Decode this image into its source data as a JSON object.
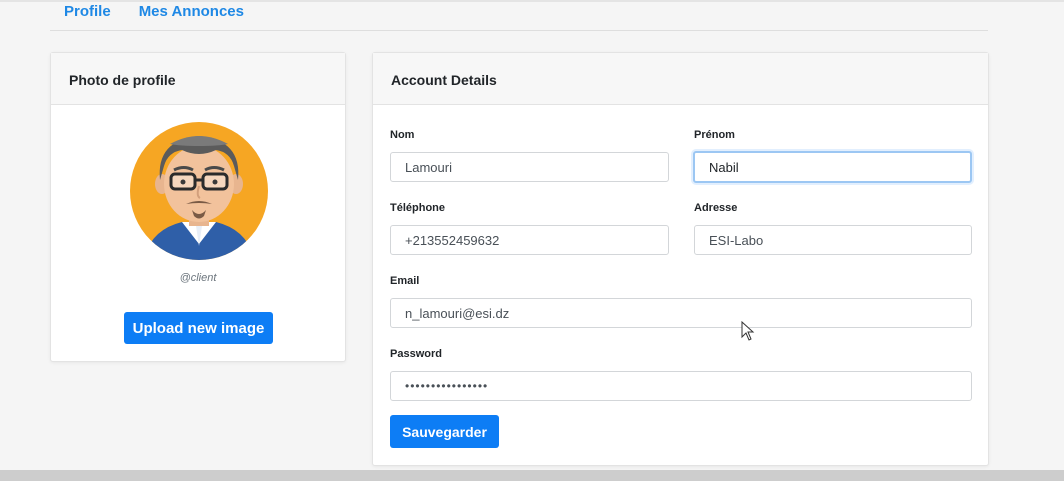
{
  "nav": {
    "profile": "Profile",
    "annonces": "Mes Annonces"
  },
  "profile_card": {
    "title": "Photo de profile",
    "handle": "@client",
    "upload_label": "Upload new image"
  },
  "account": {
    "title": "Account Details",
    "nom_label": "Nom",
    "nom_value": "Lamouri",
    "prenom_label": "Prénom",
    "prenom_value": "Nabil",
    "telephone_label": "Téléphone",
    "telephone_value": "+213552459632",
    "adresse_label": "Adresse",
    "adresse_value": "ESI-Labo",
    "email_label": "Email",
    "email_value": "n_lamouri@esi.dz",
    "password_label": "Password",
    "password_value": "••••••••••••••••",
    "save_label": "Sauvegarder"
  },
  "colors": {
    "accent": "#0d7df5",
    "link": "#1e88e5",
    "avatar_bg": "#f6a623"
  }
}
